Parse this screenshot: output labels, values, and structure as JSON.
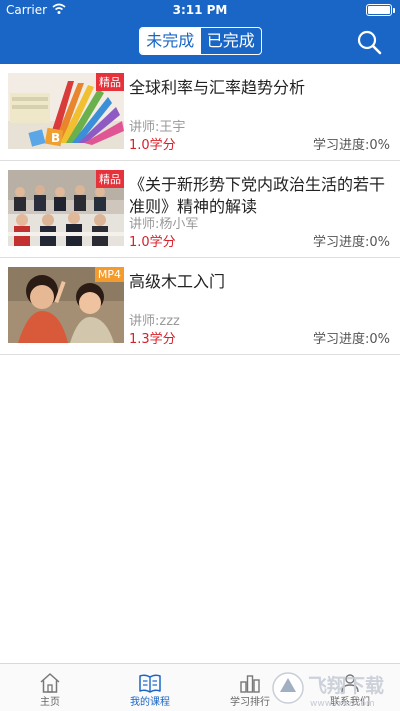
{
  "status_bar": {
    "carrier": "Carrier",
    "time": "3:11 PM"
  },
  "nav": {
    "segments": [
      {
        "label": "未完成",
        "active": true
      },
      {
        "label": "已完成",
        "active": false
      }
    ],
    "search_icon": "search-icon"
  },
  "courses": [
    {
      "title": "全球利率与汇率趋势分析",
      "tag": "精品",
      "teacher": "讲师:王宇",
      "credit": "1.0学分",
      "progress": "学习进度:0%"
    },
    {
      "title": "《关于新形势下党内政治生活的若干准则》精神的解读",
      "tag": "精品",
      "teacher": "讲师:杨小军",
      "credit": "1.0学分",
      "progress": "学习进度:0%"
    },
    {
      "title": "高级木工入门",
      "tag": "MP4",
      "teacher": "讲师:zzz",
      "credit": "1.3学分",
      "progress": "学习进度:0%"
    }
  ],
  "tabbar": {
    "items": [
      {
        "label": "主页",
        "icon": "home-icon",
        "active": false
      },
      {
        "label": "我的课程",
        "icon": "book-icon",
        "active": true
      },
      {
        "label": "学习排行",
        "icon": "ranking-icon",
        "active": false
      },
      {
        "label": "联系我们",
        "icon": "contact-icon",
        "active": false
      }
    ]
  },
  "watermark": {
    "text": "飞翔下载",
    "url_text": "www.fxxz.com"
  },
  "colors": {
    "primary": "#1a66c6",
    "credit_red": "#d7202a",
    "tag_red": "#e5323b",
    "tag_orange": "#f39b2d"
  }
}
